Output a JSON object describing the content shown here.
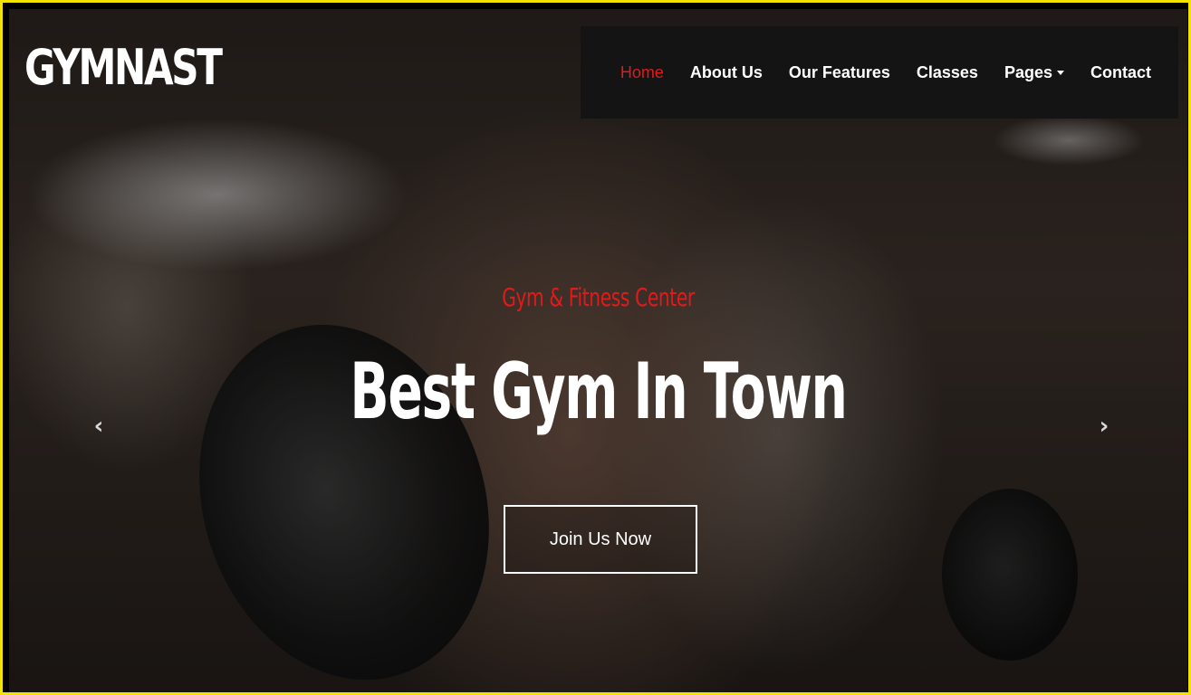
{
  "brand": {
    "logo_text": "GYMNAST"
  },
  "nav": {
    "items": [
      {
        "label": "Home",
        "active": true
      },
      {
        "label": "About Us"
      },
      {
        "label": "Our Features"
      },
      {
        "label": "Classes"
      },
      {
        "label": "Pages",
        "has_dropdown": true
      },
      {
        "label": "Contact"
      }
    ]
  },
  "hero": {
    "subtitle": "Gym & Fitness Center",
    "headline": "Best Gym In Town",
    "cta_label": "Join Us Now",
    "prev_icon": "chevron-left-icon",
    "next_icon": "chevron-right-icon",
    "prev_glyph": "‹",
    "next_glyph": "›"
  },
  "colors": {
    "accent": "#e01b1b",
    "navbar_bg": "#141414",
    "frame_border": "#f2e400",
    "text": "#ffffff"
  }
}
